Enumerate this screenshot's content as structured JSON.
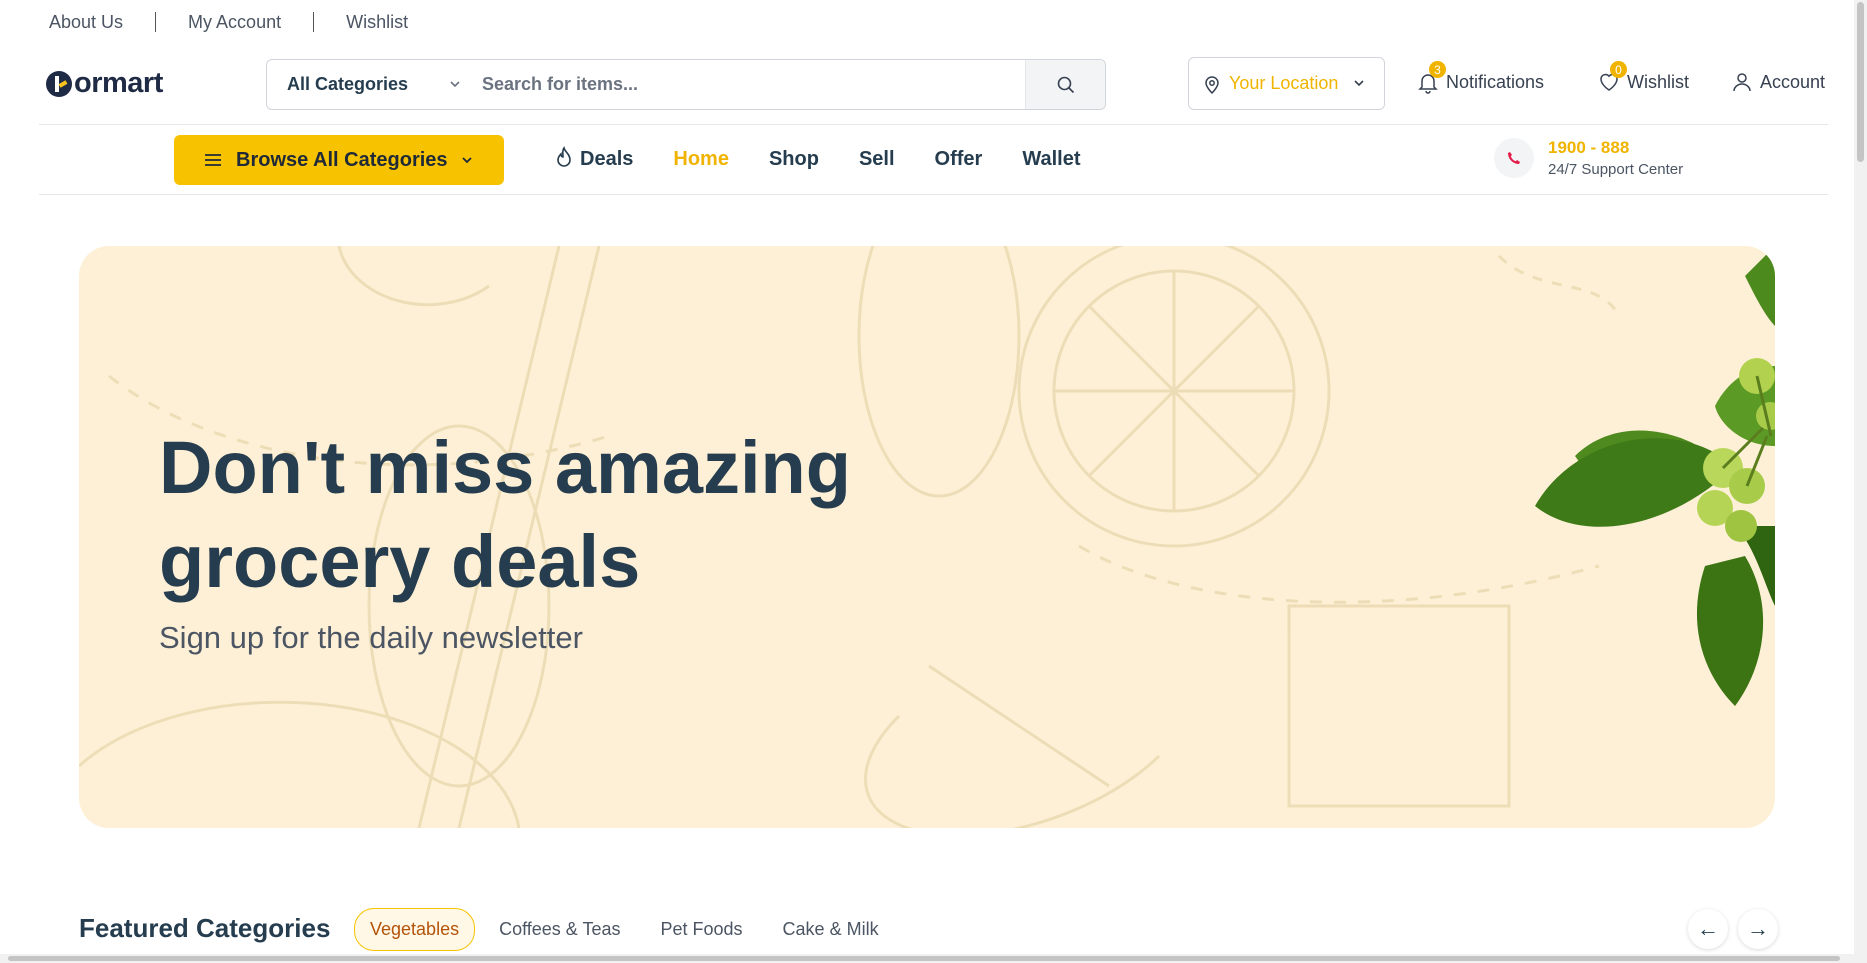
{
  "topbar": {
    "links": [
      "About Us",
      "My Account",
      "Wishlist"
    ]
  },
  "header": {
    "logo_text": "ormart",
    "search": {
      "category": "All Categories",
      "placeholder": "Search for items..."
    },
    "location": "Your Location",
    "notifications": {
      "label": "Notifications",
      "count": "3"
    },
    "wishlist": {
      "label": "Wishlist",
      "count": "0"
    },
    "account": {
      "label": "Account"
    }
  },
  "nav": {
    "browse_label": "Browse All Categories",
    "items": [
      "Deals",
      "Home",
      "Shop",
      "Sell",
      "Offer",
      "Wallet"
    ],
    "active": "Home",
    "support_number": "1900 - 888",
    "support_label": "24/7 Support Center"
  },
  "hero": {
    "title_line1": "Don't miss amazing",
    "title_line2": "grocery deals",
    "subtitle": "Sign up for the daily newsletter"
  },
  "featured": {
    "title": "Featured Categories",
    "tabs": [
      "Vegetables",
      "Coffees & Teas",
      "Pet Foods",
      "Cake & Milk"
    ],
    "active_tab": "Vegetables",
    "prev_arrow": "←",
    "next_arrow": "→"
  },
  "colors": {
    "accent": "#f7c300",
    "accent_text": "#f0b400",
    "heading": "#253d4e",
    "hero_bg": "#fef0d6"
  }
}
